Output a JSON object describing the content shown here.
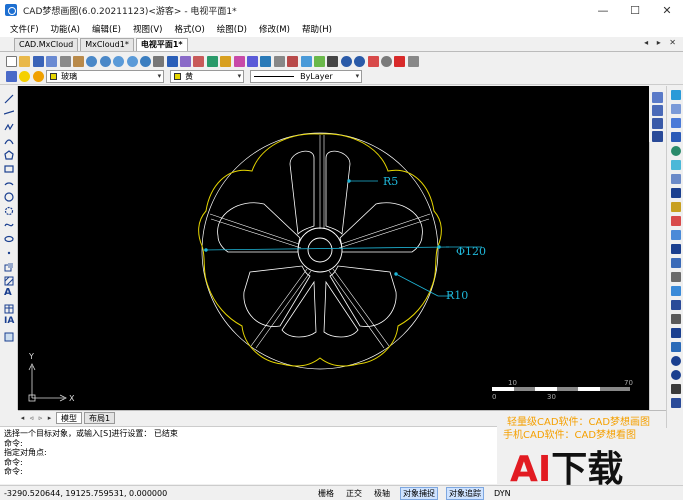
{
  "window": {
    "title": "CAD梦想画图(6.0.20211123)<游客> - 电视平面1*",
    "minimize": "—",
    "maximize": "☐",
    "close": "✕"
  },
  "menu": [
    "文件(F)",
    "功能(A)",
    "编辑(E)",
    "视图(V)",
    "格式(O)",
    "绘图(D)",
    "修改(M)",
    "帮助(H)"
  ],
  "tabs": [
    {
      "label": "CAD.MxCloud"
    },
    {
      "label": "MxCloud1*"
    },
    {
      "label": "电视平面1*"
    }
  ],
  "tabbar_controls": "◂ ▸ ✕",
  "layer": {
    "name": "玻璃",
    "color_name": "黄",
    "linetype": "ByLayer"
  },
  "drawing": {
    "label_r5": "R5",
    "label_diameter": "Φ120",
    "label_r10": "R10",
    "ucs_x": "X",
    "ucs_y": "Y",
    "scale_ticks": [
      "0",
      "10",
      "30",
      "70"
    ]
  },
  "layout_tabs": [
    "模型",
    "布局1"
  ],
  "command_lines": [
    "选择一个目标对象，或输入[S]进行设置：  已结束",
    "命令:",
    " 指定对角点:",
    "命令:",
    "命令:"
  ],
  "status": {
    "coords": "-3290.520644,  19125.759531,  0.000000",
    "buttons": [
      {
        "label": "栅格",
        "on": false
      },
      {
        "label": "正交",
        "on": false
      },
      {
        "label": "极轴",
        "on": false
      },
      {
        "label": "对象捕捉",
        "on": true
      },
      {
        "label": "对象追踪",
        "on": true
      },
      {
        "label": "DYN",
        "on": false
      }
    ]
  },
  "watermark": {
    "line1": "轻量级CAD软件：CAD梦想画图",
    "line2": "手机CAD软件：CAD梦想看图",
    "logo_ai": "AI",
    "logo_rest": "下载"
  },
  "colors": {
    "canvas": "#000000",
    "geometry": "#ffffff",
    "yellow_layer": "#e6d600",
    "dimension": "#1fb7d9",
    "accent_red": "#e21b22"
  }
}
